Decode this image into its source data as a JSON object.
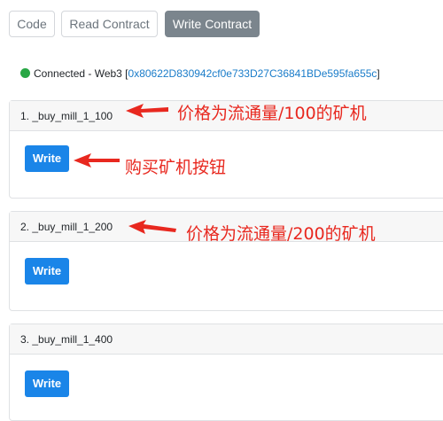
{
  "tabs": [
    "Code",
    "Read Contract",
    "Write Contract"
  ],
  "status": {
    "text": "Connected - Web3 [",
    "address": "0x80622D830942cf0e733D27C36841BDe595fa655c",
    "close": "]",
    "indicator_color": "#28a745"
  },
  "functions": [
    {
      "header": "1. _buy_mill_1_100",
      "button": "Write"
    },
    {
      "header": "2. _buy_mill_1_200",
      "button": "Write"
    },
    {
      "header": "3. _buy_mill_1_400",
      "button": "Write"
    }
  ],
  "annotations": {
    "price_100": "价格为流通量/100的矿机",
    "buy_button": "购买矿机按钮",
    "price_200": "价格为流通量/200的矿机"
  },
  "colors": {
    "accent": "#1a85e8",
    "annotation": "#e8281f",
    "active_tab": "#7b858d"
  }
}
